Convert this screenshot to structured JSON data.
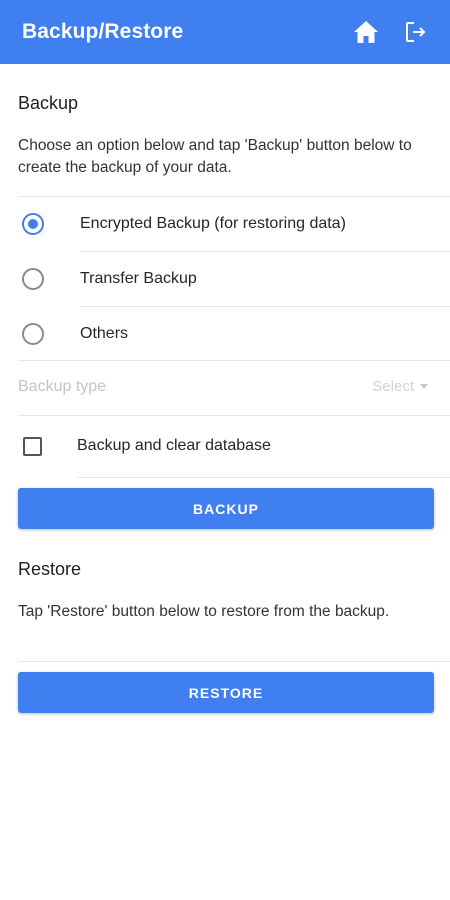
{
  "app_bar": {
    "title": "Backup/Restore",
    "home_icon": "home-icon",
    "logout_icon": "logout-icon",
    "color": "#3f7ff0"
  },
  "backup": {
    "title": "Backup",
    "description": "Choose an option below and tap 'Backup' button below to create the backup of your data.",
    "options": [
      {
        "label": "Encrypted Backup (for restoring data)",
        "selected": true
      },
      {
        "label": "Transfer Backup",
        "selected": false
      },
      {
        "label": "Others",
        "selected": false
      }
    ],
    "backup_type": {
      "label": "Backup type",
      "value": "Select"
    },
    "clear_database": {
      "label": "Backup and clear database",
      "checked": false
    },
    "button_label": "BACKUP"
  },
  "restore": {
    "title": "Restore",
    "description": "Tap 'Restore' button below to restore from the backup.",
    "button_label": "RESTORE"
  }
}
